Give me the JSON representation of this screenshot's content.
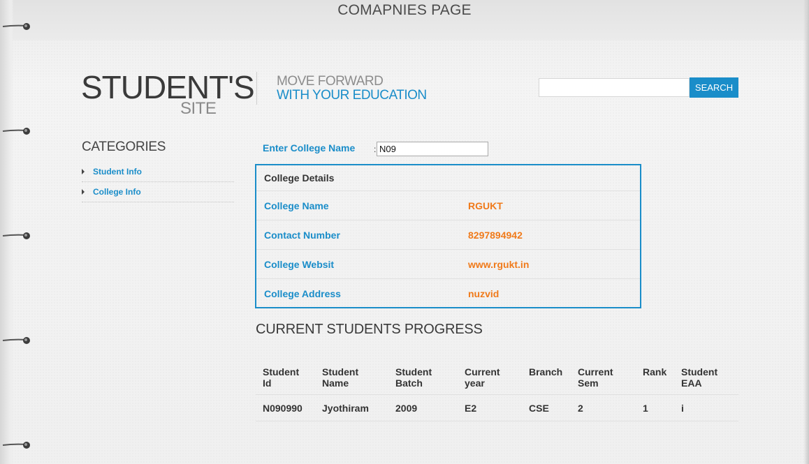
{
  "page": {
    "heading": "COMAPNIES PAGE"
  },
  "logo": {
    "main": "STUDENT'S",
    "sub": "SITE"
  },
  "tagline": {
    "line1": "MOVE FORWARD",
    "line2": "WITH YOUR EDUCATION"
  },
  "search": {
    "value": "",
    "button_label": "SEARCH"
  },
  "categories": {
    "title": "CATEGORIES",
    "items": [
      {
        "label": "Student Info",
        "icon": "chevron-right-icon"
      },
      {
        "label": "College Info",
        "icon": "chevron-right-icon"
      }
    ]
  },
  "college_search": {
    "label": "Enter College Name",
    "colon": ":",
    "value": "N09"
  },
  "college_details": {
    "title": "College Details",
    "rows": [
      {
        "key": "College Name",
        "value": "RGUKT"
      },
      {
        "key": "Contact Number",
        "value": "8297894942"
      },
      {
        "key": "College Websit",
        "value": "www.rgukt.in"
      },
      {
        "key": "College Address",
        "value": "nuzvid"
      }
    ]
  },
  "progress": {
    "title": "CURRENT STUDENTS PROGRESS",
    "headers": [
      [
        "Student",
        "Id"
      ],
      [
        "Student",
        "Name"
      ],
      [
        "Student",
        "Batch"
      ],
      [
        "Current",
        "year"
      ],
      [
        "Branch",
        ""
      ],
      [
        "Current",
        "Sem"
      ],
      [
        "Rank",
        ""
      ],
      [
        "Student",
        "EAA"
      ]
    ],
    "rows": [
      [
        "N090990",
        "Jyothiram",
        "2009",
        "E2",
        "CSE",
        "2",
        "1",
        "i"
      ]
    ]
  },
  "colors": {
    "accent": "#1a8dc9",
    "value": "#f07a1a",
    "text": "#333333"
  }
}
